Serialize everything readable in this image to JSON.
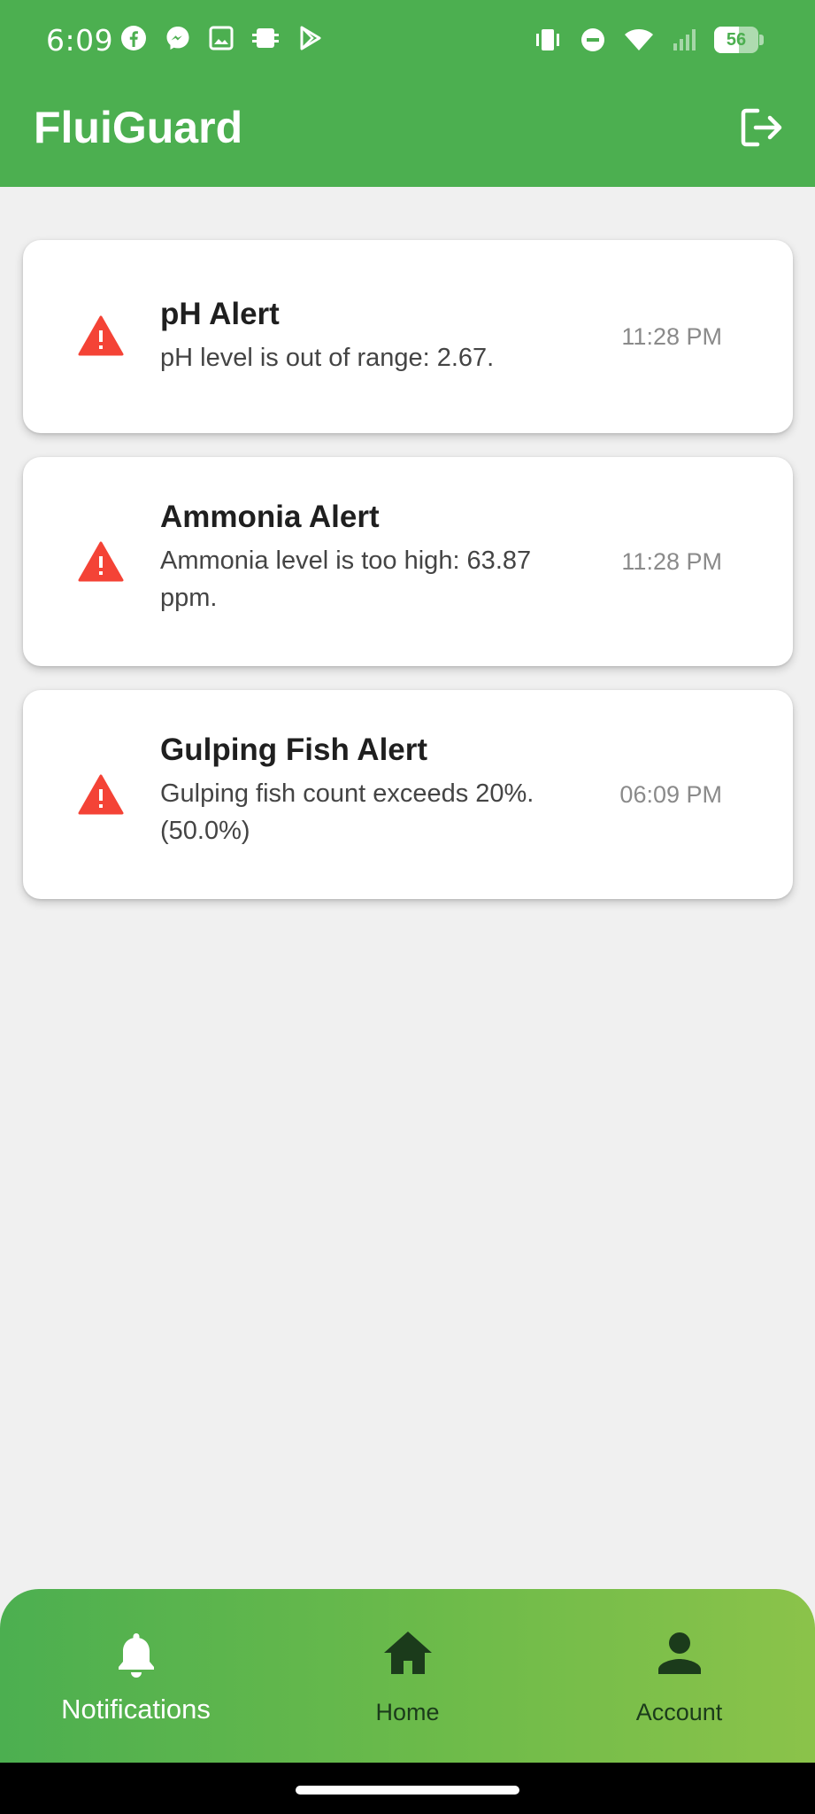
{
  "status_bar": {
    "time": "6:09",
    "battery_level": "56",
    "battery_fraction": 0.56,
    "left_icons": [
      "facebook-icon",
      "messenger-icon",
      "gallery-icon",
      "system-icon",
      "play-store-icon"
    ],
    "right_icons": [
      "vibrate-icon",
      "do-not-disturb-icon",
      "wifi-icon",
      "signal-icon",
      "battery-icon"
    ]
  },
  "header": {
    "title": "FluiGuard",
    "logout_icon": "logout-icon"
  },
  "colors": {
    "primary": "#4caf50",
    "accent_end": "#8bc34a",
    "alert_red": "#f44336",
    "background": "#f0f0f0"
  },
  "alerts": [
    {
      "title": "pH Alert",
      "message": "pH level is out of range: 2.67.",
      "time": "11:28 PM",
      "icon": "warning-icon"
    },
    {
      "title": "Ammonia Alert",
      "message": "Ammonia level is too high: 63.87 ppm.",
      "time": "11:28 PM",
      "icon": "warning-icon"
    },
    {
      "title": "Gulping Fish Alert",
      "message": "Gulping fish count exceeds 20%. (50.0%)",
      "time": "06:09 PM",
      "icon": "warning-icon"
    }
  ],
  "bottom_nav": {
    "items": [
      {
        "label": "Notifications",
        "icon": "bell-icon",
        "active": true
      },
      {
        "label": "Home",
        "icon": "home-icon",
        "active": false
      },
      {
        "label": "Account",
        "icon": "account-icon",
        "active": false
      }
    ]
  }
}
